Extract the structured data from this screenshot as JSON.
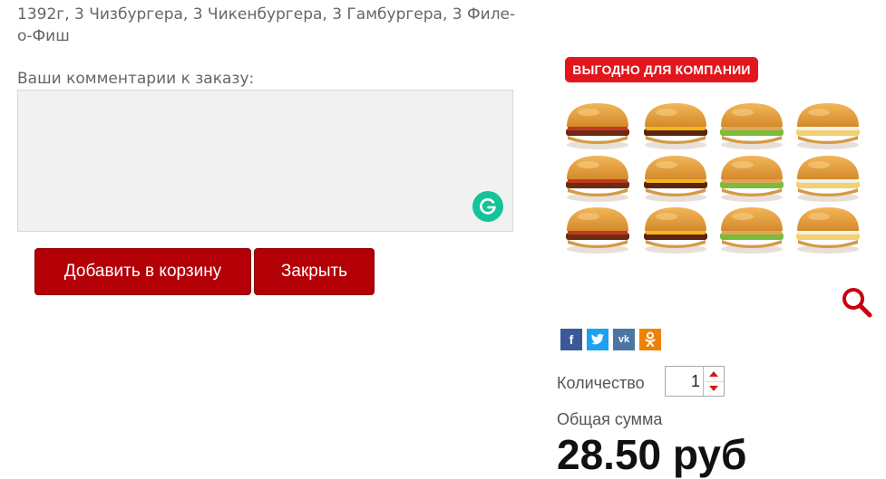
{
  "product": {
    "description": "1392г, 3 Чизбургера, 3 Чикенбургера, 3 Гамбургера, 3 Филе-о-Фиш",
    "banner": "ВЫГОДНО ДЛЯ КОМПАНИИ",
    "zoom_icon": "magnifier-icon"
  },
  "comments": {
    "label": "Ваши комментарии к заказу:",
    "value": "",
    "grammarly_icon": "grammarly-icon"
  },
  "buttons": {
    "add_to_cart": "Добавить в корзину",
    "close": "Закрыть"
  },
  "share": {
    "icons": [
      "facebook-icon",
      "twitter-icon",
      "vk-icon",
      "odnoklassniki-icon"
    ],
    "colors": [
      "#3b5998",
      "#1da1f2",
      "#4c75a3",
      "#ee8208"
    ]
  },
  "quantity": {
    "label": "Количество",
    "value": "1"
  },
  "total": {
    "label": "Общая сумма",
    "value": "28.50 руб"
  },
  "colors": {
    "button_bg": "#b30007",
    "banner_bg": "#e3151d",
    "zoom": "#c8000d"
  }
}
